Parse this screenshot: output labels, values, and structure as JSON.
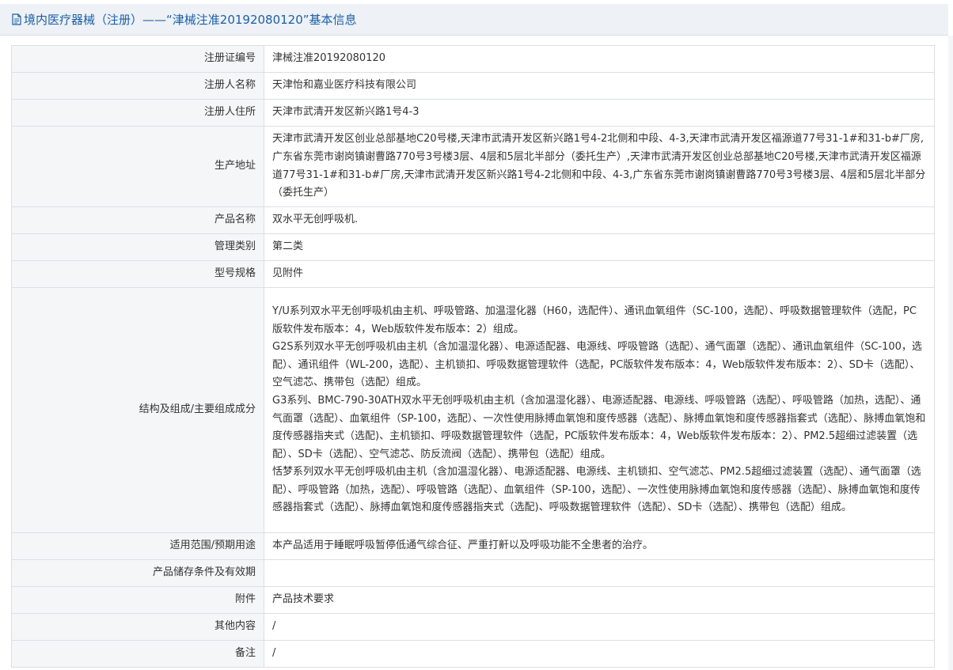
{
  "header": {
    "title": "境内医疗器械（注册）——“津械注准20192080120”基本信息",
    "icon": "document-icon",
    "title_color": "#1b5fa8"
  },
  "rows": [
    {
      "label": "注册证编号",
      "value": "津械注准20192080120"
    },
    {
      "label": "注册人名称",
      "value": "天津怡和嘉业医疗科技有限公司"
    },
    {
      "label": "注册人住所",
      "value": "天津市武清开发区新兴路1号4-3"
    },
    {
      "label": "生产地址",
      "value": "天津市武清开发区创业总部基地C20号楼,天津市武清开发区新兴路1号4-2北侧和中段、4-3,天津市武清开发区福源道77号31-1#和31-b#厂房,广东省东莞市谢岗镇谢曹路770号3号楼3层、4层和5层北半部分（委托生产）,天津市武清开发区创业总部基地C20号楼,天津市武清开发区福源道77号31-1#和31-b#厂房,天津市武清开发区新兴路1号4-2北侧和中段、4-3,广东省东莞市谢岗镇谢曹路770号3号楼3层、4层和5层北半部分（委托生产）"
    },
    {
      "label": "产品名称",
      "value": "双水平无创呼吸机."
    },
    {
      "label": "管理类别",
      "value": "第二类"
    },
    {
      "label": "型号规格",
      "value": "见附件"
    },
    {
      "label": "结构及组成/主要组成成分",
      "paragraphs": [
        "Y/U系列双水平无创呼吸机由主机、呼吸管路、加温湿化器（H60，选配件）、通讯血氧组件（SC-100，选配）、呼吸数据管理软件（选配，PC版软件发布版本：4，Web版软件发布版本：2）组成。",
        "G2S系列双水平无创呼吸机由主机（含加温湿化器）、电源适配器、电源线、呼吸管路（选配）、通气面罩（选配）、通讯血氧组件（SC-100，选配）、通讯组件（WL-200，选配）、主机锁扣、呼吸数据管理软件（选配，PC版软件发布版本：4，Web版软件发布版本：2）、SD卡（选配）、空气滤芯、携带包（选配）组成。",
        "G3系列、BMC-790-30ATH双水平无创呼吸机由主机（含加温湿化器）、电源适配器、电源线、呼吸管路（选配）、呼吸管路（加热，选配）、通气面罩（选配）、血氧组件（SP-100，选配）、一次性使用脉搏血氧饱和度传感器（选配）、脉搏血氧饱和度传感器指套式（选配）、脉搏血氧饱和度传感器指夹式（选配)、主机锁扣、呼吸数据管理软件（选配，PC版软件发布版本：4，Web版软件发布版本：2）、PM2.5超细过滤装置（选配）、SD卡（选配）、空气滤芯、防反流阀（选配）、携带包（选配）组成。",
        "恬梦系列双水平无创呼吸机由主机（含加温湿化器）、电源适配器、电源线、主机锁扣、空气滤芯、PM2.5超细过滤装置（选配）、通气面罩（选配）、呼吸管路（加热，选配）、呼吸管路（选配）、血氧组件（SP-100，选配）、一次性使用脉搏血氧饱和度传感器（选配）、脉搏血氧饱和度传感器指套式（选配）、脉搏血氧饱和度传感器指夹式（选配)、呼吸数据管理软件（选配）、SD卡（选配）、携带包（选配）组成。"
      ]
    },
    {
      "label": "适用范围/预期用途",
      "value": "本产品适用于睡眠呼吸暂停低通气综合征、严重打鼾以及呼吸功能不全患者的治疗。"
    },
    {
      "label": "产品储存条件及有效期",
      "value": ""
    },
    {
      "label": "附件",
      "value": "产品技术要求"
    },
    {
      "label": "其他内容",
      "value": "/"
    },
    {
      "label": "备注",
      "value": "/"
    }
  ]
}
